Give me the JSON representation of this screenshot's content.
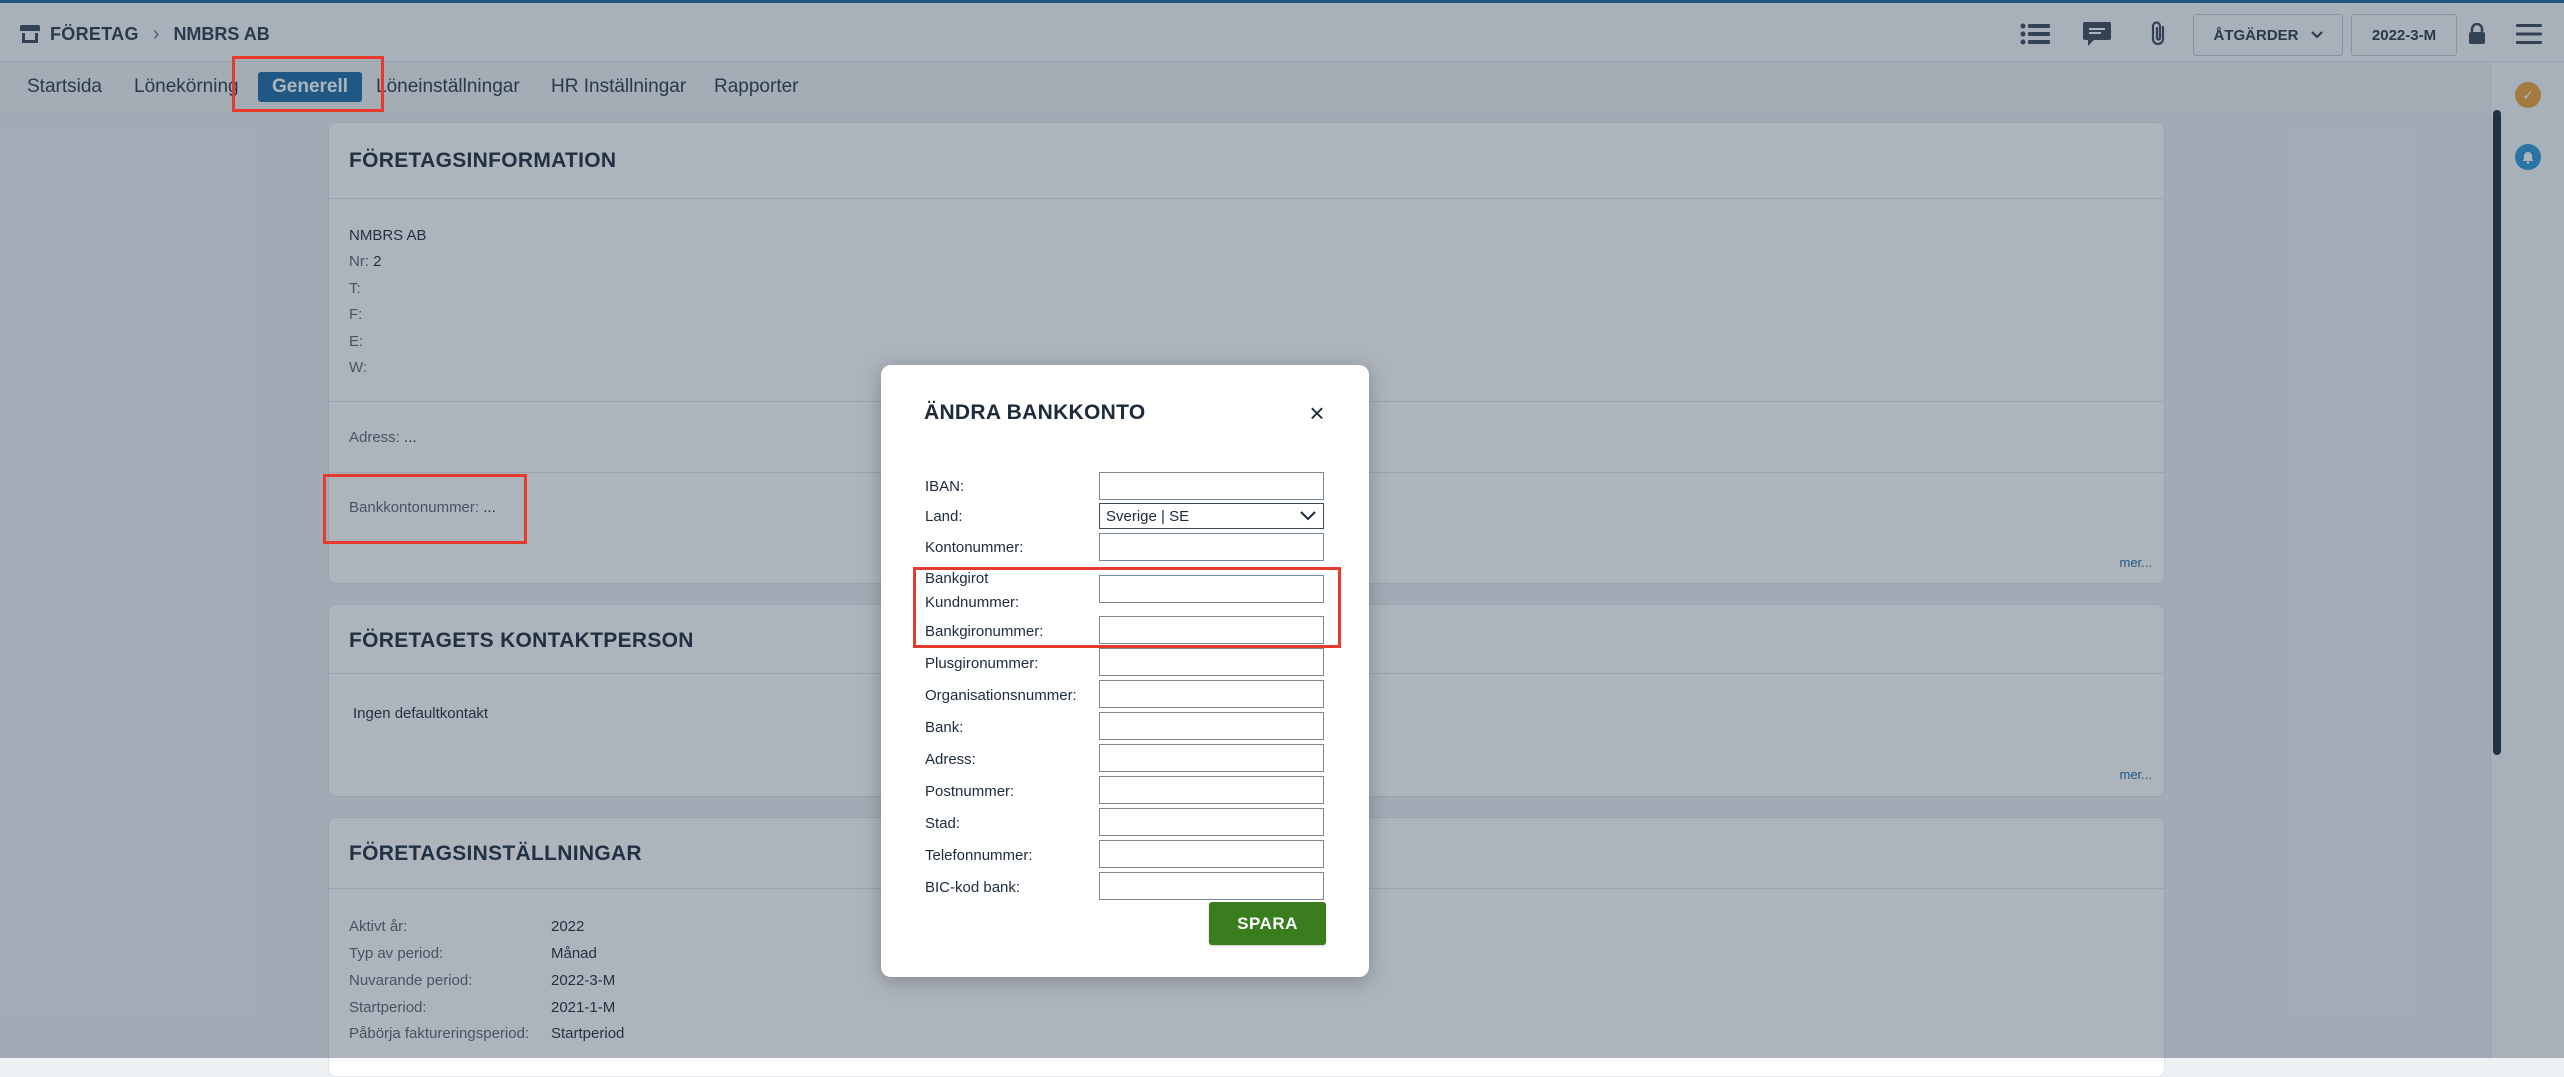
{
  "breadcrumb": {
    "level1": "FÖRETAG",
    "level2": "NMBRS AB"
  },
  "toolbar": {
    "actions_label": "ÅTGÄRDER",
    "period_label": "2022-3-M"
  },
  "tabs": [
    {
      "label": "Startsida"
    },
    {
      "label": "Lönekörning"
    },
    {
      "label": "Generell"
    },
    {
      "label": "Löneinställningar"
    },
    {
      "label": "HR Inställningar"
    },
    {
      "label": "Rapporter"
    }
  ],
  "company_info": {
    "title": "FÖRETAGSINFORMATION",
    "name": "NMBRS AB",
    "nr_label": "Nr:",
    "nr_value": "2",
    "t_label": "T:",
    "f_label": "F:",
    "e_label": "E:",
    "w_label": "W:",
    "address_label": "Adress:",
    "address_value": "...",
    "bank_label": "Bankkontonummer:",
    "bank_value": "...",
    "more": "mer..."
  },
  "contact": {
    "title": "FÖRETAGETS KONTAKTPERSON",
    "text": "Ingen defaultkontakt",
    "more": "mer..."
  },
  "settings": {
    "title": "FÖRETAGSINSTÄLLNINGAR",
    "rows": [
      {
        "label": "Aktivt år:",
        "value": "2022"
      },
      {
        "label": "Typ av period:",
        "value": "Månad"
      },
      {
        "label": "Nuvarande period:",
        "value": "2022-3-M"
      },
      {
        "label": "Startperiod:",
        "value": "2021-1-M"
      },
      {
        "label": "Påbörja faktureringsperiod:",
        "value": "Startperiod"
      }
    ]
  },
  "modal": {
    "title": "ÄNDRA BANKKONTO",
    "close": "×",
    "fields": {
      "iban": "IBAN:",
      "land": "Land:",
      "land_value": "Sverige | SE",
      "kontonummer": "Kontonummer:",
      "bankgirot_1": "Bankgirot",
      "bankgirot_2": "Kundnummer:",
      "bankgironummer": "Bankgironummer:",
      "plusgironummer": "Plusgironummer:",
      "organisationsnummer": "Organisationsnummer:",
      "bank": "Bank:",
      "adress": "Adress:",
      "postnummer": "Postnummer:",
      "stad": "Stad:",
      "telefonnummer": "Telefonnummer:",
      "bic": "BIC-kod bank:"
    },
    "save_label": "SPARA"
  },
  "colors": {
    "accent": "#1a6aa6",
    "save": "#3a7d1f",
    "highlight": "#e63a2e",
    "badge_orange": "#f0a23a",
    "badge_blue": "#2a9bd8"
  }
}
